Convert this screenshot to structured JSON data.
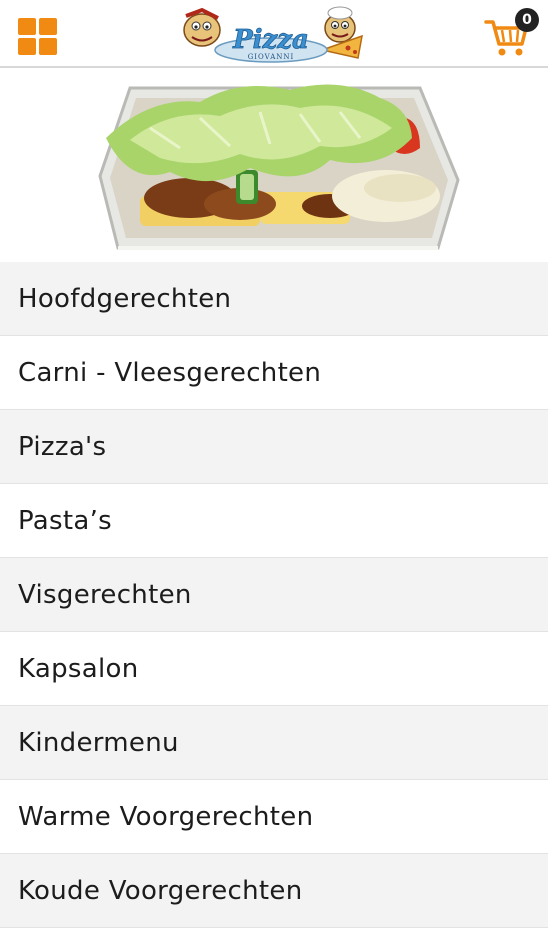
{
  "header": {
    "menu_icon": "grid-menu-icon",
    "logo": {
      "brand": "Pizza",
      "sub": "GIOVANNI"
    },
    "cart": {
      "icon": "shopping-cart-icon",
      "count": "0"
    }
  },
  "hero": {
    "image": "kapsalon-dish-photo"
  },
  "colors": {
    "accent": "#f08a12",
    "row_alt": "#f3f3f3",
    "text": "#1c1c1c"
  },
  "categories": [
    {
      "label": "Hoofdgerechten"
    },
    {
      "label": "Carni - Vleesgerechten"
    },
    {
      "label": "Pizza's"
    },
    {
      "label": "Pasta’s"
    },
    {
      "label": "Visgerechten"
    },
    {
      "label": "Kapsalon"
    },
    {
      "label": "Kindermenu"
    },
    {
      "label": "Warme Voorgerechten"
    },
    {
      "label": "Koude Voorgerechten"
    }
  ]
}
